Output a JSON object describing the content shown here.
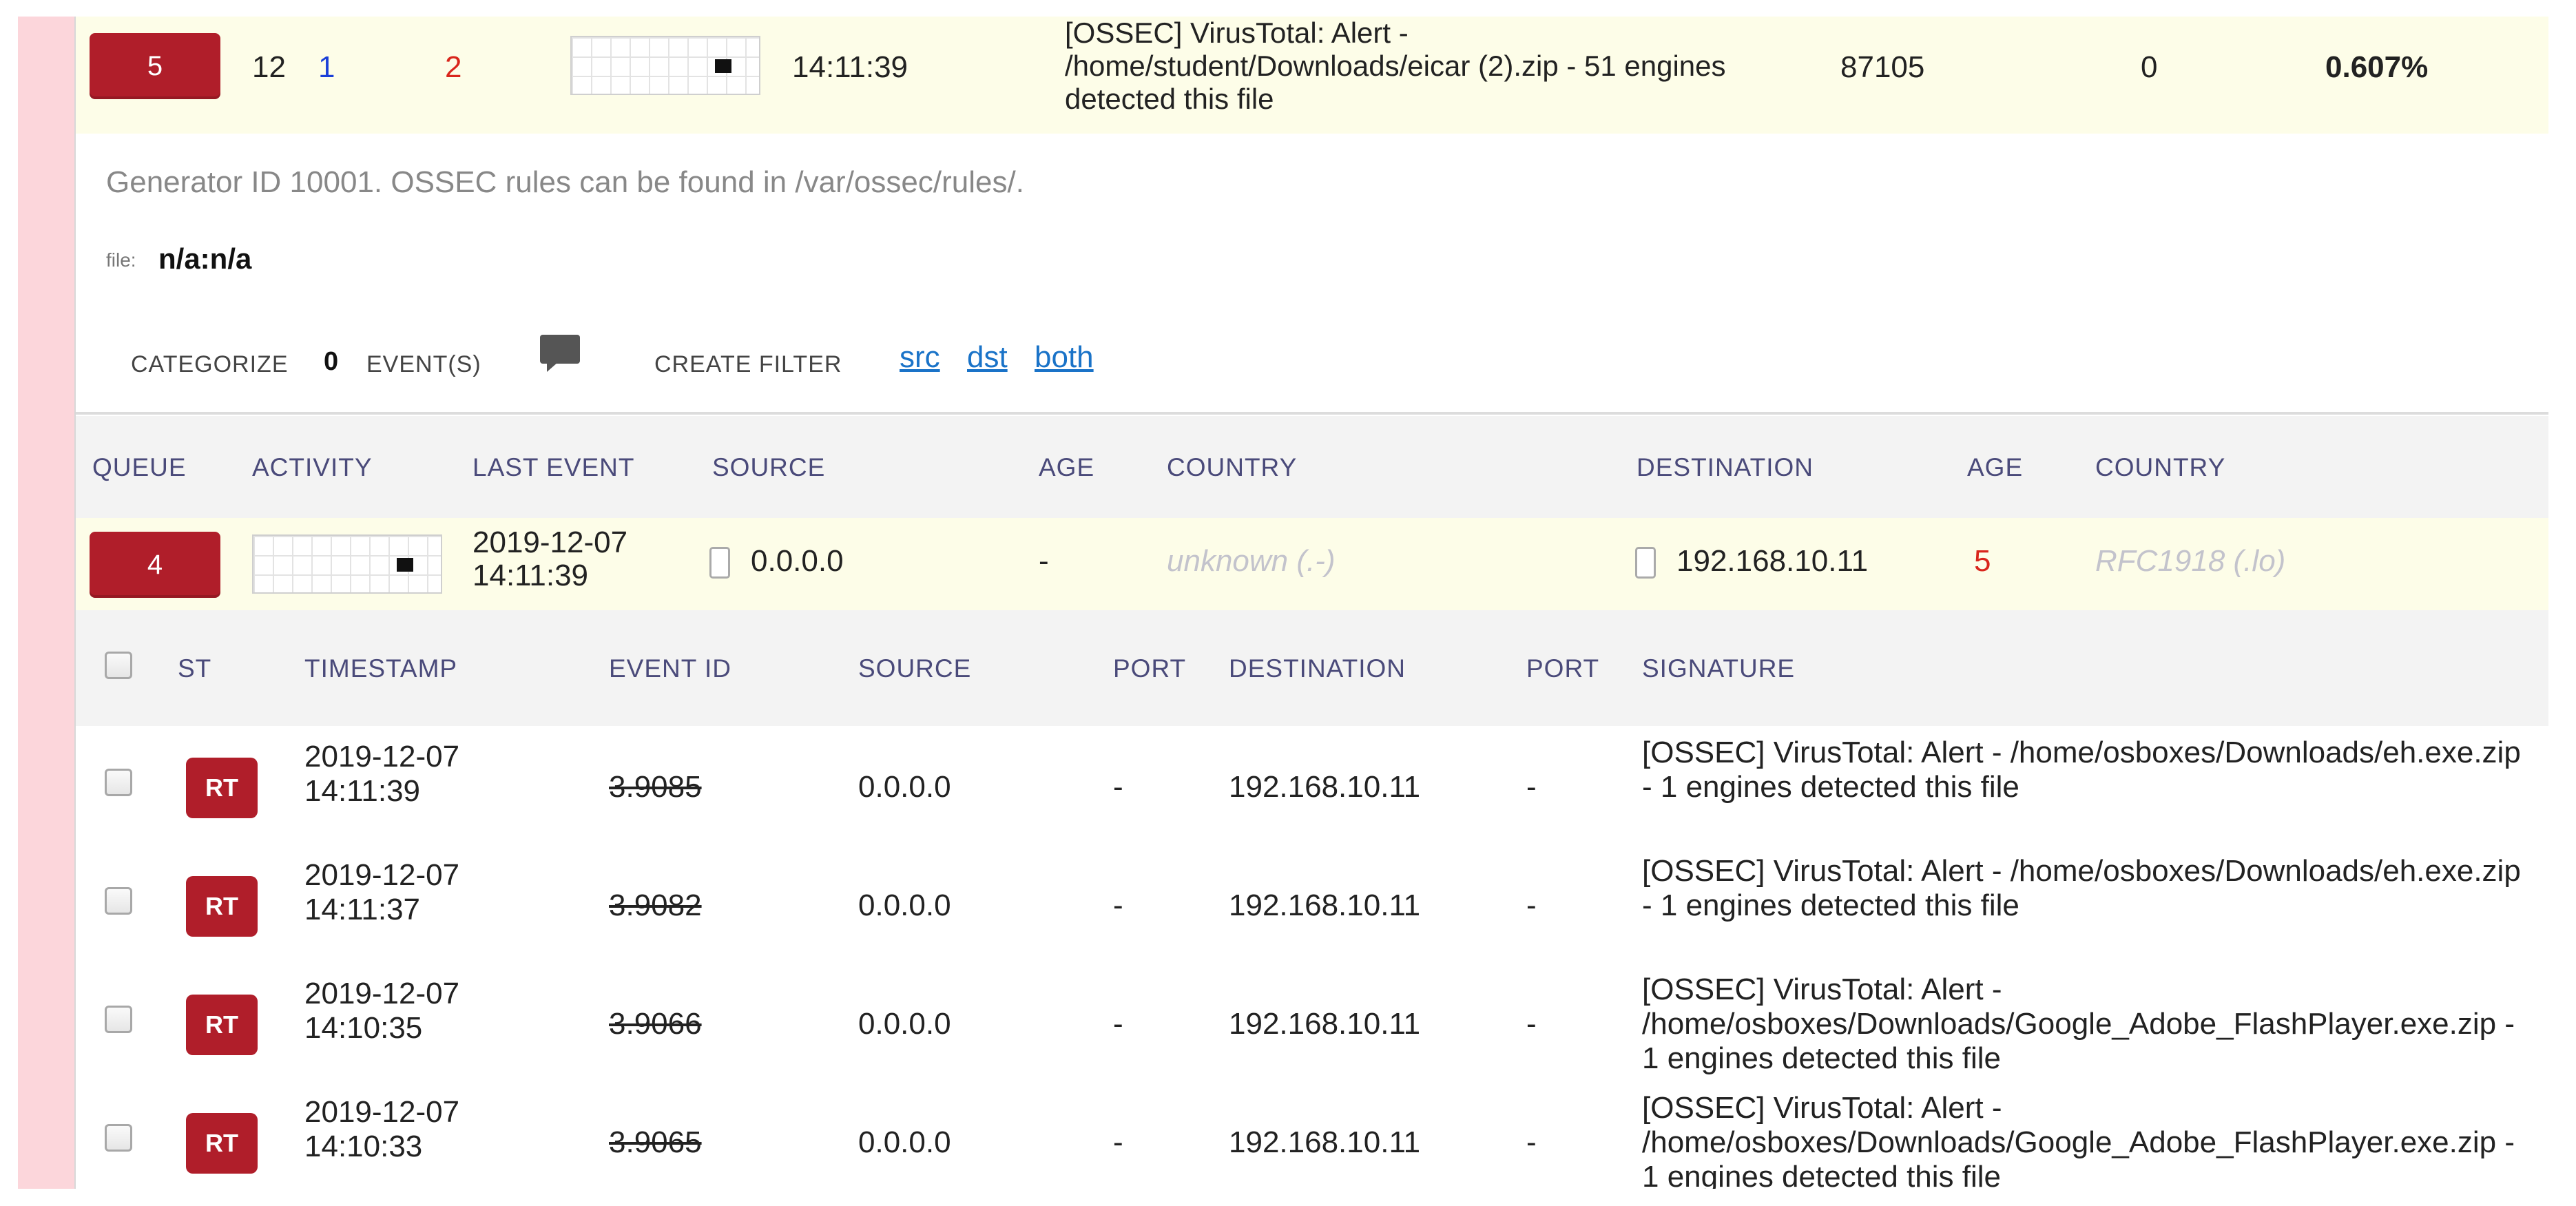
{
  "alert": {
    "count": "5",
    "col_a": "12",
    "col_b": "1",
    "col_c": "2",
    "time": "14:11:39",
    "signature": "[OSSEC] VirusTotal: Alert - /home/student/Downloads/eicar (2).zip - 51 engines detected this file",
    "sid": "87105",
    "zero": "0",
    "percent": "0.607%"
  },
  "generator_text": "Generator ID 10001. OSSEC rules can be found in /var/ossec/rules/.",
  "file": {
    "label": "file:",
    "value": "n/a:n/a"
  },
  "actions": {
    "categorize": "CATEGORIZE",
    "count": "0",
    "events": "EVENT(S)",
    "create_filter": "CREATE FILTER",
    "src": "src",
    "dst": "dst",
    "both": "both"
  },
  "queue_headers": [
    "QUEUE",
    "ACTIVITY",
    "LAST EVENT",
    "SOURCE",
    "AGE",
    "COUNTRY",
    "DESTINATION",
    "AGE",
    "COUNTRY"
  ],
  "queue_row": {
    "queue": "4",
    "last_event_date": "2019-12-07",
    "last_event_time": "14:11:39",
    "source": "0.0.0.0",
    "src_age": "-",
    "src_country": "unknown (.-)",
    "destination": "192.168.10.11",
    "dst_age": "5",
    "dst_country": "RFC1918 (.lo)"
  },
  "event_headers": [
    "ST",
    "TIMESTAMP",
    "EVENT ID",
    "SOURCE",
    "PORT",
    "DESTINATION",
    "PORT",
    "SIGNATURE"
  ],
  "events": [
    {
      "st": "RT",
      "date": "2019-12-07",
      "time": "14:11:39",
      "event_id": "3.9085",
      "source": "0.0.0.0",
      "sport": "-",
      "destination": "192.168.10.11",
      "dport": "-",
      "signature": "[OSSEC] VirusTotal: Alert - /home/osboxes/Downloads/eh.exe.zip - 1 engines detected this file"
    },
    {
      "st": "RT",
      "date": "2019-12-07",
      "time": "14:11:37",
      "event_id": "3.9082",
      "source": "0.0.0.0",
      "sport": "-",
      "destination": "192.168.10.11",
      "dport": "-",
      "signature": "[OSSEC] VirusTotal: Alert - /home/osboxes/Downloads/eh.exe.zip - 1 engines detected this file"
    },
    {
      "st": "RT",
      "date": "2019-12-07",
      "time": "14:10:35",
      "event_id": "3.9066",
      "source": "0.0.0.0",
      "sport": "-",
      "destination": "192.168.10.11",
      "dport": "-",
      "signature": "[OSSEC] VirusTotal: Alert - /home/osboxes/Downloads/Google_Adobe_FlashPlayer.exe.zip - 1 engines detected this file"
    },
    {
      "st": "RT",
      "date": "2019-12-07",
      "time": "14:10:33",
      "event_id": "3.9065",
      "source": "0.0.0.0",
      "sport": "-",
      "destination": "192.168.10.11",
      "dport": "-",
      "signature": "[OSSEC] VirusTotal: Alert - /home/osboxes/Downloads/Google_Adobe_FlashPlayer.exe.zip - 1 engines detected this file"
    }
  ],
  "colors": {
    "accent_red": "#b01e2a",
    "link_blue": "#1a73c8",
    "row_highlight": "#fdfde8",
    "side_bar": "#fcd6db"
  }
}
